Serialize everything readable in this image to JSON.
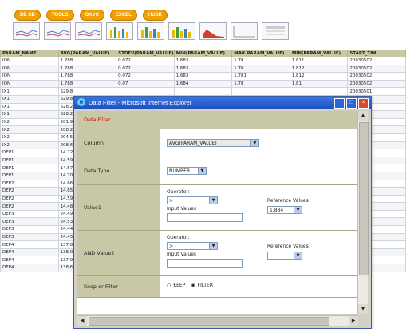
{
  "toolbar": {
    "buttons": [
      "DB CB",
      "TOOLS",
      "OKVC",
      "EXCEL",
      "HUSK"
    ]
  },
  "chart_thumbs": [
    "line-chart-icon",
    "line-chart-icon",
    "line-chart-icon",
    "bar-chart-icon",
    "bar-chart-icon",
    "bar-chart-icon",
    "area-chart-icon",
    "blank-chart-icon",
    "table-chart-icon"
  ],
  "table": {
    "headers": [
      "PARAM_NAME",
      "AVG(PARAM_VALUE)",
      "STDEV(PARAM_VALUE)",
      "MIN(PARAM_VALUE)",
      "MAX(PARAM_VALUE)",
      "MIN(PARAM_VALUE)",
      "START_TIM"
    ],
    "rows": [
      [
        "ION",
        "1.788",
        "0.072",
        "1.683",
        "1.78",
        "1.811",
        "20030502"
      ],
      [
        "ION",
        "1.788",
        "0.072",
        "1.683",
        "1.78",
        "1.812",
        "20030502"
      ],
      [
        "ION",
        "1.788",
        "0.072",
        "1.683",
        "1.781",
        "1.812",
        "20030502"
      ],
      [
        "ION",
        "1.788",
        "0.07",
        "1.684",
        "1.78",
        "1.81",
        "20030502"
      ],
      [
        "IX1",
        "529.8",
        "",
        "",
        "",
        "",
        "20030501"
      ],
      [
        "IX1",
        "529.8",
        "",
        "",
        "",
        "",
        "20030502"
      ],
      [
        "IX1",
        "528.25",
        "",
        "",
        "",
        "",
        "20030502"
      ],
      [
        "IX1",
        "528.25",
        "",
        "",
        "",
        "",
        "20030505"
      ],
      [
        "IX2",
        "201.95",
        "",
        "",
        "",
        "",
        "20030502"
      ],
      [
        "IX2",
        "208.25",
        "",
        "",
        "",
        "",
        "20030501"
      ],
      [
        "IX2",
        "204.52",
        "",
        "",
        "",
        "",
        "20030502"
      ],
      [
        "IX2",
        "208.63",
        "",
        "",
        "",
        "",
        "20030502"
      ],
      [
        "DEP1",
        "14.727",
        "",
        "",
        "",
        "",
        "20030502"
      ],
      [
        "DEP1",
        "14.597",
        "",
        "",
        "",
        "",
        "20030501"
      ],
      [
        "DEP1",
        "14.577",
        "",
        "",
        "",
        "",
        "20030502"
      ],
      [
        "DEP1",
        "14.705",
        "",
        "",
        "",
        "",
        "20030502"
      ],
      [
        "DEP2",
        "14.666",
        "",
        "",
        "",
        "",
        "20030502"
      ],
      [
        "DEP2",
        "14.658",
        "",
        "",
        "",
        "",
        "20030501"
      ],
      [
        "DEP2",
        "14.592",
        "",
        "",
        "",
        "",
        "20030502"
      ],
      [
        "DEP2",
        "14.488",
        "",
        "",
        "",
        "",
        "20030502"
      ],
      [
        "DEP3",
        "24.496",
        "",
        "",
        "",
        "",
        "20030502"
      ],
      [
        "DEP3",
        "24.53",
        "",
        "",
        "",
        "",
        "20030502"
      ],
      [
        "DEP3",
        "24.445",
        "",
        "",
        "",
        "",
        "20030502"
      ],
      [
        "DEP3",
        "24.452",
        "",
        "",
        "",
        "",
        "20030502"
      ],
      [
        "DEP4",
        "137.83",
        "",
        "",
        "",
        "",
        "20030502"
      ],
      [
        "DEP4",
        "138.07",
        "",
        "",
        "",
        "",
        "20030501"
      ],
      [
        "DEP4",
        "137.93",
        "",
        "",
        "",
        "",
        "20030502"
      ],
      [
        "DEP4",
        "138.69",
        "",
        "",
        "",
        "",
        "20030502"
      ]
    ]
  },
  "dialog": {
    "title": "Data Filter - Microsoft Internet Explorer",
    "heading": "Data Filter",
    "column_label": "Column",
    "column_value": "AVG(PARAM_VALUE)",
    "data_type_label": "Data Type",
    "data_type_value": "NUMBER",
    "value1_label": "Value1",
    "operator_label": "Operator:",
    "operator_value": ">",
    "input_values_label": "Input Values",
    "reference_values_label": "Reference Values:",
    "reference1_value": "1.884",
    "and_value2_label": "AND Value2",
    "reference2_value": "",
    "keep_filter_label": "Keep or Filter",
    "keep_option": "KEEP",
    "filter_option": "FILTER"
  }
}
